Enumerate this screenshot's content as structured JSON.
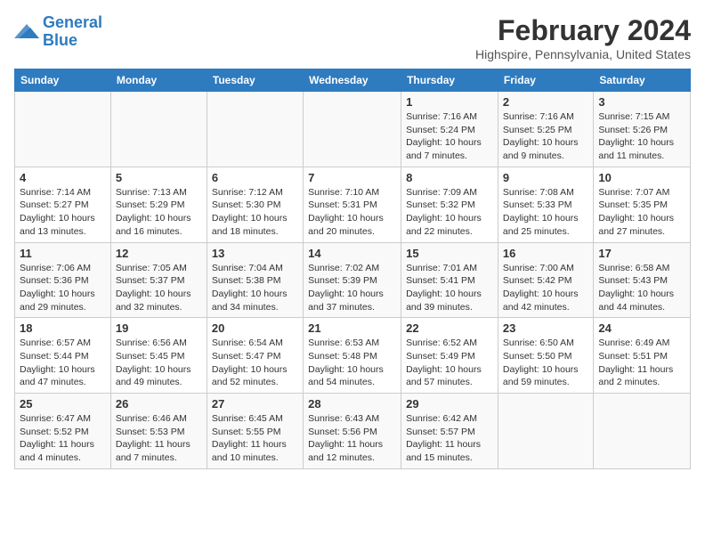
{
  "logo": {
    "line1": "General",
    "line2": "Blue"
  },
  "title": "February 2024",
  "subtitle": "Highspire, Pennsylvania, United States",
  "days_of_week": [
    "Sunday",
    "Monday",
    "Tuesday",
    "Wednesday",
    "Thursday",
    "Friday",
    "Saturday"
  ],
  "weeks": [
    [
      {
        "day": "",
        "info": ""
      },
      {
        "day": "",
        "info": ""
      },
      {
        "day": "",
        "info": ""
      },
      {
        "day": "",
        "info": ""
      },
      {
        "day": "1",
        "info": "Sunrise: 7:16 AM\nSunset: 5:24 PM\nDaylight: 10 hours\nand 7 minutes."
      },
      {
        "day": "2",
        "info": "Sunrise: 7:16 AM\nSunset: 5:25 PM\nDaylight: 10 hours\nand 9 minutes."
      },
      {
        "day": "3",
        "info": "Sunrise: 7:15 AM\nSunset: 5:26 PM\nDaylight: 10 hours\nand 11 minutes."
      }
    ],
    [
      {
        "day": "4",
        "info": "Sunrise: 7:14 AM\nSunset: 5:27 PM\nDaylight: 10 hours\nand 13 minutes."
      },
      {
        "day": "5",
        "info": "Sunrise: 7:13 AM\nSunset: 5:29 PM\nDaylight: 10 hours\nand 16 minutes."
      },
      {
        "day": "6",
        "info": "Sunrise: 7:12 AM\nSunset: 5:30 PM\nDaylight: 10 hours\nand 18 minutes."
      },
      {
        "day": "7",
        "info": "Sunrise: 7:10 AM\nSunset: 5:31 PM\nDaylight: 10 hours\nand 20 minutes."
      },
      {
        "day": "8",
        "info": "Sunrise: 7:09 AM\nSunset: 5:32 PM\nDaylight: 10 hours\nand 22 minutes."
      },
      {
        "day": "9",
        "info": "Sunrise: 7:08 AM\nSunset: 5:33 PM\nDaylight: 10 hours\nand 25 minutes."
      },
      {
        "day": "10",
        "info": "Sunrise: 7:07 AM\nSunset: 5:35 PM\nDaylight: 10 hours\nand 27 minutes."
      }
    ],
    [
      {
        "day": "11",
        "info": "Sunrise: 7:06 AM\nSunset: 5:36 PM\nDaylight: 10 hours\nand 29 minutes."
      },
      {
        "day": "12",
        "info": "Sunrise: 7:05 AM\nSunset: 5:37 PM\nDaylight: 10 hours\nand 32 minutes."
      },
      {
        "day": "13",
        "info": "Sunrise: 7:04 AM\nSunset: 5:38 PM\nDaylight: 10 hours\nand 34 minutes."
      },
      {
        "day": "14",
        "info": "Sunrise: 7:02 AM\nSunset: 5:39 PM\nDaylight: 10 hours\nand 37 minutes."
      },
      {
        "day": "15",
        "info": "Sunrise: 7:01 AM\nSunset: 5:41 PM\nDaylight: 10 hours\nand 39 minutes."
      },
      {
        "day": "16",
        "info": "Sunrise: 7:00 AM\nSunset: 5:42 PM\nDaylight: 10 hours\nand 42 minutes."
      },
      {
        "day": "17",
        "info": "Sunrise: 6:58 AM\nSunset: 5:43 PM\nDaylight: 10 hours\nand 44 minutes."
      }
    ],
    [
      {
        "day": "18",
        "info": "Sunrise: 6:57 AM\nSunset: 5:44 PM\nDaylight: 10 hours\nand 47 minutes."
      },
      {
        "day": "19",
        "info": "Sunrise: 6:56 AM\nSunset: 5:45 PM\nDaylight: 10 hours\nand 49 minutes."
      },
      {
        "day": "20",
        "info": "Sunrise: 6:54 AM\nSunset: 5:47 PM\nDaylight: 10 hours\nand 52 minutes."
      },
      {
        "day": "21",
        "info": "Sunrise: 6:53 AM\nSunset: 5:48 PM\nDaylight: 10 hours\nand 54 minutes."
      },
      {
        "day": "22",
        "info": "Sunrise: 6:52 AM\nSunset: 5:49 PM\nDaylight: 10 hours\nand 57 minutes."
      },
      {
        "day": "23",
        "info": "Sunrise: 6:50 AM\nSunset: 5:50 PM\nDaylight: 10 hours\nand 59 minutes."
      },
      {
        "day": "24",
        "info": "Sunrise: 6:49 AM\nSunset: 5:51 PM\nDaylight: 11 hours\nand 2 minutes."
      }
    ],
    [
      {
        "day": "25",
        "info": "Sunrise: 6:47 AM\nSunset: 5:52 PM\nDaylight: 11 hours\nand 4 minutes."
      },
      {
        "day": "26",
        "info": "Sunrise: 6:46 AM\nSunset: 5:53 PM\nDaylight: 11 hours\nand 7 minutes."
      },
      {
        "day": "27",
        "info": "Sunrise: 6:45 AM\nSunset: 5:55 PM\nDaylight: 11 hours\nand 10 minutes."
      },
      {
        "day": "28",
        "info": "Sunrise: 6:43 AM\nSunset: 5:56 PM\nDaylight: 11 hours\nand 12 minutes."
      },
      {
        "day": "29",
        "info": "Sunrise: 6:42 AM\nSunset: 5:57 PM\nDaylight: 11 hours\nand 15 minutes."
      },
      {
        "day": "",
        "info": ""
      },
      {
        "day": "",
        "info": ""
      }
    ]
  ]
}
